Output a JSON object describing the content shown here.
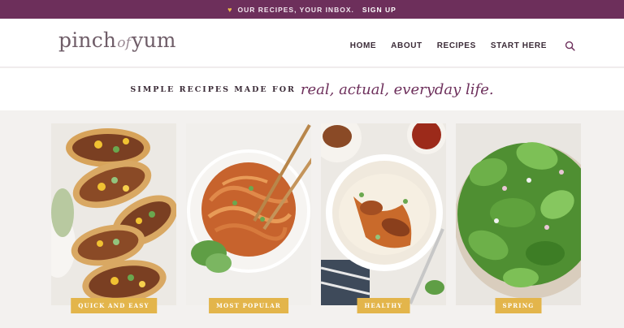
{
  "promo": {
    "icon": "heart-icon",
    "text": "OUR RECIPES, YOUR INBOX.",
    "link": "SIGN UP"
  },
  "brand": {
    "part1": "pinch",
    "part2": "of",
    "part3": "yum"
  },
  "nav": {
    "items": [
      "HOME",
      "ABOUT",
      "RECIPES",
      "START HERE"
    ],
    "search_icon": "search-icon"
  },
  "tagline": {
    "plain": "SIMPLE RECIPES MADE FOR",
    "script": "real, actual, everyday life."
  },
  "categories": [
    {
      "label": "QUICK AND EASY",
      "image": "tacos"
    },
    {
      "label": "MOST POPULAR",
      "image": "noodles-bowl"
    },
    {
      "label": "HEALTHY",
      "image": "chicken-rice-bowl"
    },
    {
      "label": "SPRING",
      "image": "green-salad"
    }
  ],
  "colors": {
    "brand_plum": "#6d2f5b",
    "badge_gold": "#e3b54b",
    "background": "#f3f1ef"
  }
}
